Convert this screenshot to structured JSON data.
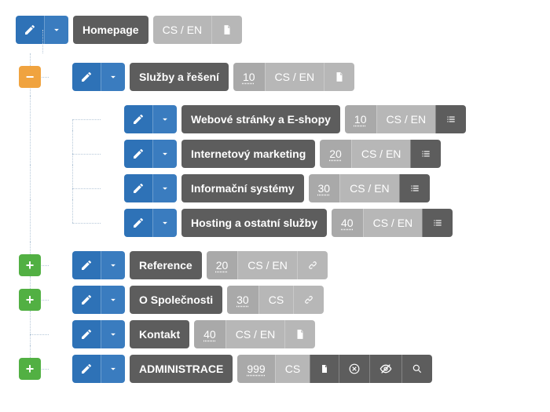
{
  "root": {
    "label": "Homepage",
    "lang": "CS / EN"
  },
  "items": [
    {
      "label": "Služby a řešení",
      "order": "10",
      "lang": "CS / EN",
      "expanded": true,
      "children": [
        {
          "label": "Webové stránky a E-shopy",
          "order": "10",
          "lang": "CS / EN"
        },
        {
          "label": "Internetový marketing",
          "order": "20",
          "lang": "CS / EN"
        },
        {
          "label": "Informační systémy",
          "order": "30",
          "lang": "CS / EN"
        },
        {
          "label": "Hosting a ostatní služby",
          "order": "40",
          "lang": "CS / EN"
        }
      ]
    },
    {
      "label": "Reference",
      "order": "20",
      "lang": "CS / EN",
      "hasChildren": true,
      "link": true
    },
    {
      "label": "O Společnosti",
      "order": "30",
      "lang": "CS",
      "hasChildren": true,
      "link": true
    },
    {
      "label": "Kontakt",
      "order": "40",
      "lang": "CS / EN",
      "hasChildren": false,
      "doc": true
    },
    {
      "label": "ADMINISTRACE",
      "order": "999",
      "lang": "CS",
      "hasChildren": true,
      "admin": true
    }
  ]
}
